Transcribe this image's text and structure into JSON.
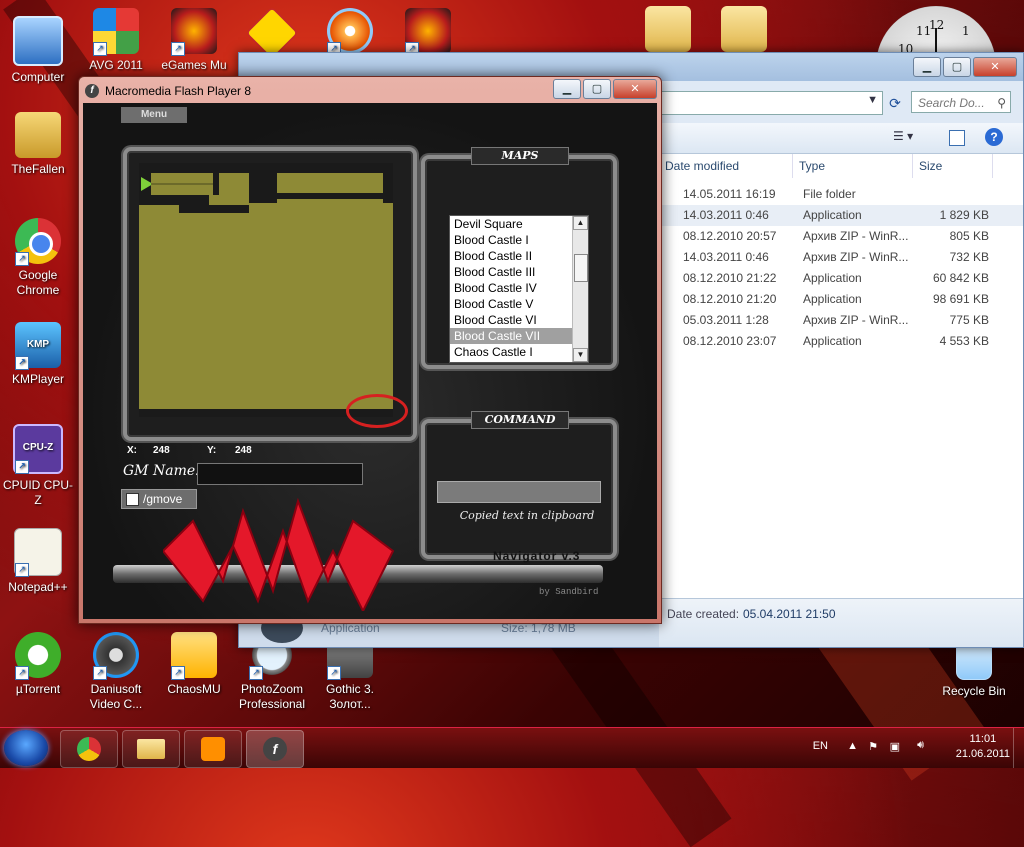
{
  "desktop": {
    "icons": [
      {
        "label": "Computer"
      },
      {
        "label": "TheFallen"
      },
      {
        "label": "Google Chrome"
      },
      {
        "label": "KMPlayer"
      },
      {
        "label": "CPUID CPU-Z"
      },
      {
        "label": "Notepad++"
      },
      {
        "label": "µTorrent"
      },
      {
        "label": "AVG 2011"
      },
      {
        "label": "eGames Mu"
      },
      {
        "label": "Daniusoft Video C..."
      },
      {
        "label": "ChaosMU"
      },
      {
        "label": "PhotoZoom Professional"
      },
      {
        "label": "Gothic 3. Золот..."
      },
      {
        "label": "Recycle Bin"
      }
    ],
    "cpuz_icon_text": "CPU-Z",
    "kmp_icon_text": "KMP",
    "clock_numbers": [
      "10",
      "11",
      "12",
      "1"
    ]
  },
  "explorer": {
    "search_placeholder": "Search Do...",
    "columns": [
      "Date modified",
      "Type",
      "Size"
    ],
    "rows": [
      {
        "date": "14.05.2011 16:19",
        "type": "File folder",
        "size": ""
      },
      {
        "date": "14.03.2011 0:46",
        "type": "Application",
        "size": "1 829 KB"
      },
      {
        "date": "08.12.2010 20:57",
        "type": "Архив ZIP - WinR...",
        "size": "805 KB"
      },
      {
        "date": "14.03.2011 0:46",
        "type": "Архив ZIP - WinR...",
        "size": "732 KB"
      },
      {
        "date": "08.12.2010 21:22",
        "type": "Application",
        "size": "60 842 KB"
      },
      {
        "date": "08.12.2010 21:20",
        "type": "Application",
        "size": "98 691 KB"
      },
      {
        "date": "05.03.2011 1:28",
        "type": "Архив ZIP - WinR...",
        "size": "775 KB"
      },
      {
        "date": "08.12.2010 23:07",
        "type": "Application",
        "size": "4 553 KB"
      }
    ],
    "details": {
      "label": "Date created:",
      "value": "05.04.2011 21:50",
      "type": "Application",
      "size": "Size: 1,78 MB"
    }
  },
  "flash": {
    "title": "Macromedia Flash Player 8",
    "menu_label": "Menu",
    "maps_title": "MAPS",
    "maps_list": [
      "Devil Square",
      "Blood Castle I",
      "Blood Castle II",
      "Blood Castle III",
      "Blood Castle IV",
      "Blood Castle V",
      "Blood Castle VI",
      "Blood Castle VII",
      "Chaos Castle I"
    ],
    "selected_map": "Blood Castle VII",
    "command_title": "COMMAND",
    "copied_text": "Copied text in clipboard",
    "x_label": "X:",
    "x_value": "248",
    "y_label": "Y:",
    "y_value": "248",
    "gm_name_label": "GM Name:",
    "gm_name_value": "",
    "gmove_label": "/gmove",
    "navigator_label": "Navigator  v.3",
    "credit": "by Sandbird"
  },
  "taskbar": {
    "language": "EN",
    "time": "11:01",
    "date": "21.06.2011"
  },
  "colors": {
    "accent_red": "#d62020",
    "map_ground": "#8e8a36"
  }
}
